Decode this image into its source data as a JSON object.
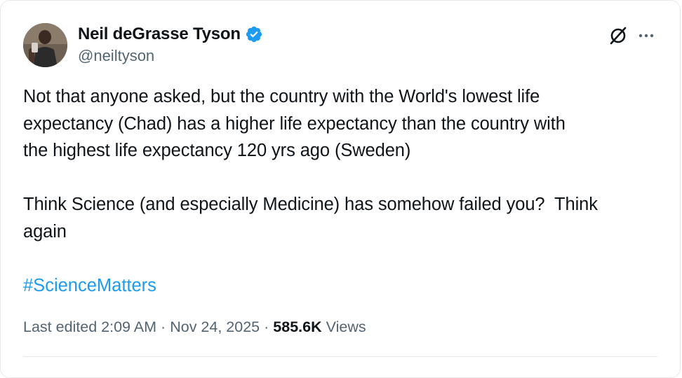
{
  "tweet": {
    "author": {
      "name": "Neil deGrasse Tyson",
      "handle": "@neiltyson",
      "verified": true
    },
    "body": "Not that anyone asked, but the country with the World's lowest life\nexpectancy (Chad) has a higher life expectancy than the country with\nthe highest life expectancy 120 yrs ago (Sweden)\n\nThink Science (and especially Medicine) has somehow failed you?  Think\nagain",
    "hashtag": "#ScienceMatters",
    "meta": {
      "edited_label": "Last edited 2:09 AM",
      "separator": "·",
      "date": "Nov 24, 2025",
      "views_count": "585.6K",
      "views_label": "Views"
    }
  },
  "icons": {
    "verified": "verified-badge-icon",
    "grok": "grok-icon",
    "more": "more-options-icon"
  },
  "colors": {
    "link": "#1d9bf0",
    "secondary_text": "#536471",
    "primary_text": "#0f1419",
    "border": "#e6e9ec"
  }
}
